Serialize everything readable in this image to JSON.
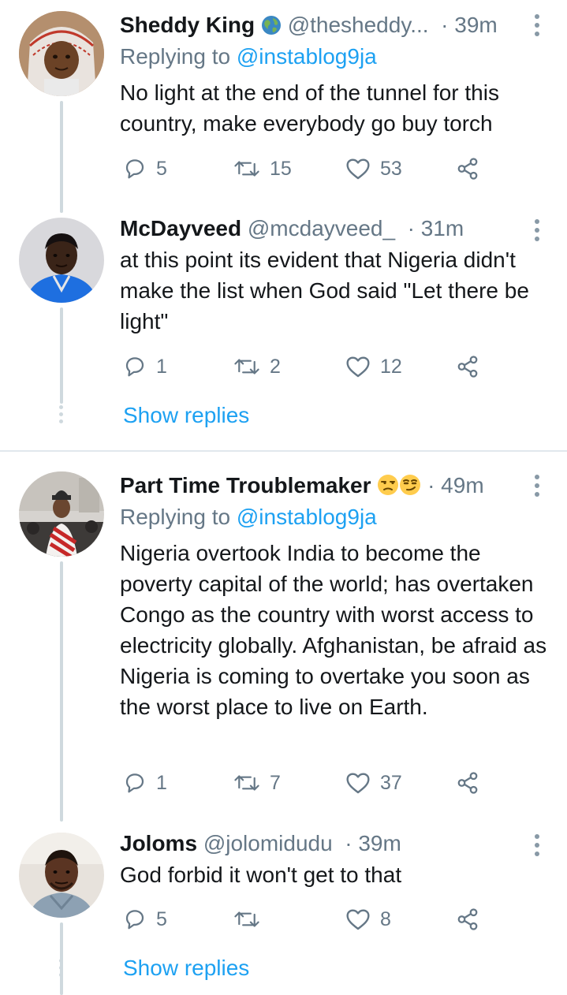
{
  "threads": [
    {
      "tweets": [
        {
          "name": "Sheddy King",
          "name_emoji": "🌍",
          "handle": "@thesheddy...",
          "time": "39m",
          "replying_prefix": "Replying to",
          "replying_to": "@instablog9ja",
          "text": "No light at the end of the tunnel for this country, make everybody go buy torch",
          "replies": "5",
          "retweets": "15",
          "likes": "53"
        },
        {
          "name": "McDayveed",
          "handle": "@mcdayveed_",
          "time": "31m",
          "text": "at this point its evident that Nigeria didn't make the list when God said \"Let there be light\"",
          "replies": "1",
          "retweets": "2",
          "likes": "12"
        }
      ],
      "show_replies": "Show replies"
    },
    {
      "tweets": [
        {
          "name": "Part Time Troublemaker",
          "name_emoji": "😒😏",
          "handle": "",
          "time": "49m",
          "replying_prefix": "Replying to",
          "replying_to": "@instablog9ja",
          "text": "Nigeria overtook India to become the poverty capital of the world; has overtaken Congo as the country with worst access to electricity globally. Afghanistan, be afraid as Nigeria is coming to overtake you soon as the worst place to live on Earth.",
          "replies": "1",
          "retweets": "7",
          "likes": "37"
        },
        {
          "name": "Joloms",
          "handle": "@jolomidudu",
          "time": "39m",
          "text": "God forbid it won't get to that",
          "replies": "5",
          "retweets": "",
          "likes": "8"
        }
      ],
      "show_replies": "Show replies"
    }
  ],
  "colors": {
    "link": "#1da1f2",
    "muted": "#657786",
    "text": "#14171a",
    "thread_line": "#cfd9de"
  },
  "icons": [
    "reply-icon",
    "retweet-icon",
    "like-icon",
    "share-icon",
    "more-options-icon"
  ]
}
